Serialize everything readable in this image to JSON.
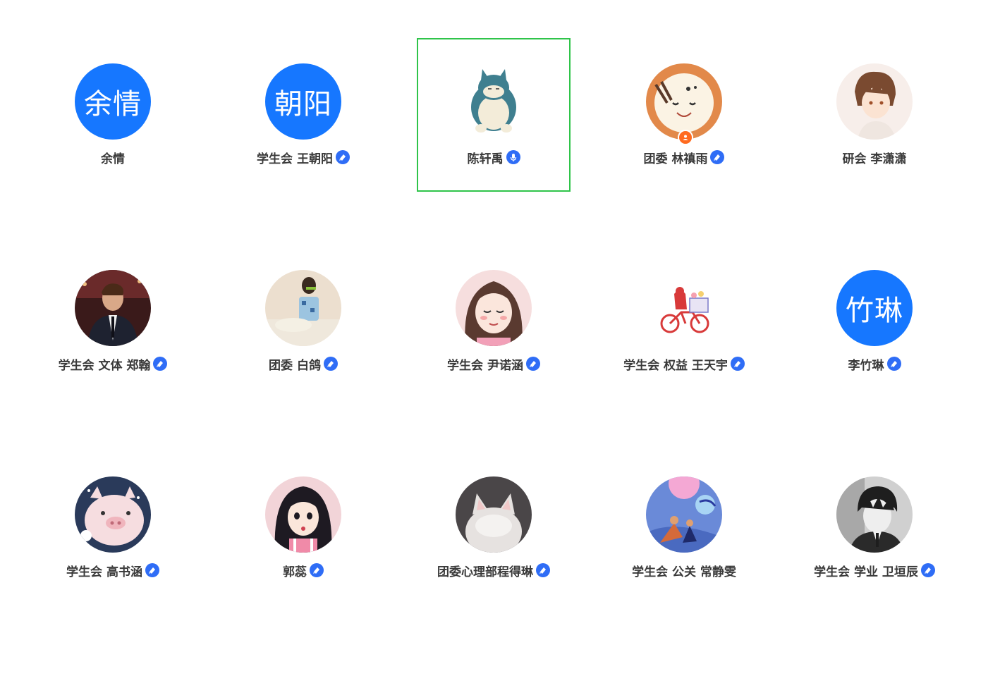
{
  "members": [
    {
      "avatar_text": "余情",
      "name": "余情",
      "badge": "none"
    },
    {
      "avatar_text": "朝阳",
      "name": "学生会 王朝阳",
      "badge": "verified"
    },
    {
      "avatar_text": "",
      "name": "陈轩禹",
      "badge": "mic"
    },
    {
      "avatar_text": "",
      "name": "团委 林禛雨",
      "badge": "verified"
    },
    {
      "avatar_text": "",
      "name": "研会 李潇潇",
      "badge": "none"
    },
    {
      "avatar_text": "",
      "name": "学生会 文体 郑翰",
      "badge": "verified"
    },
    {
      "avatar_text": "",
      "name": "团委 白鸽",
      "badge": "verified"
    },
    {
      "avatar_text": "",
      "name": "学生会 尹诺涵",
      "badge": "verified"
    },
    {
      "avatar_text": "",
      "name": "学生会  权益 王天宇",
      "badge": "verified"
    },
    {
      "avatar_text": "竹琳",
      "name": "李竹琳",
      "badge": "verified"
    },
    {
      "avatar_text": "",
      "name": "学生会 高书涵",
      "badge": "verified"
    },
    {
      "avatar_text": "",
      "name": "郭蕊",
      "badge": "verified"
    },
    {
      "avatar_text": "",
      "name": "团委心理部程得琳",
      "badge": "verified"
    },
    {
      "avatar_text": "",
      "name": "学生会 公关 常静雯",
      "badge": "none"
    },
    {
      "avatar_text": "",
      "name": "学生会 学业 卫垣辰",
      "badge": "verified"
    }
  ],
  "colors": {
    "accent": "#1677ff",
    "badge": "#2f6df6",
    "selection_border": "#2fc44a",
    "admin_badge": "#ff6a1f"
  }
}
